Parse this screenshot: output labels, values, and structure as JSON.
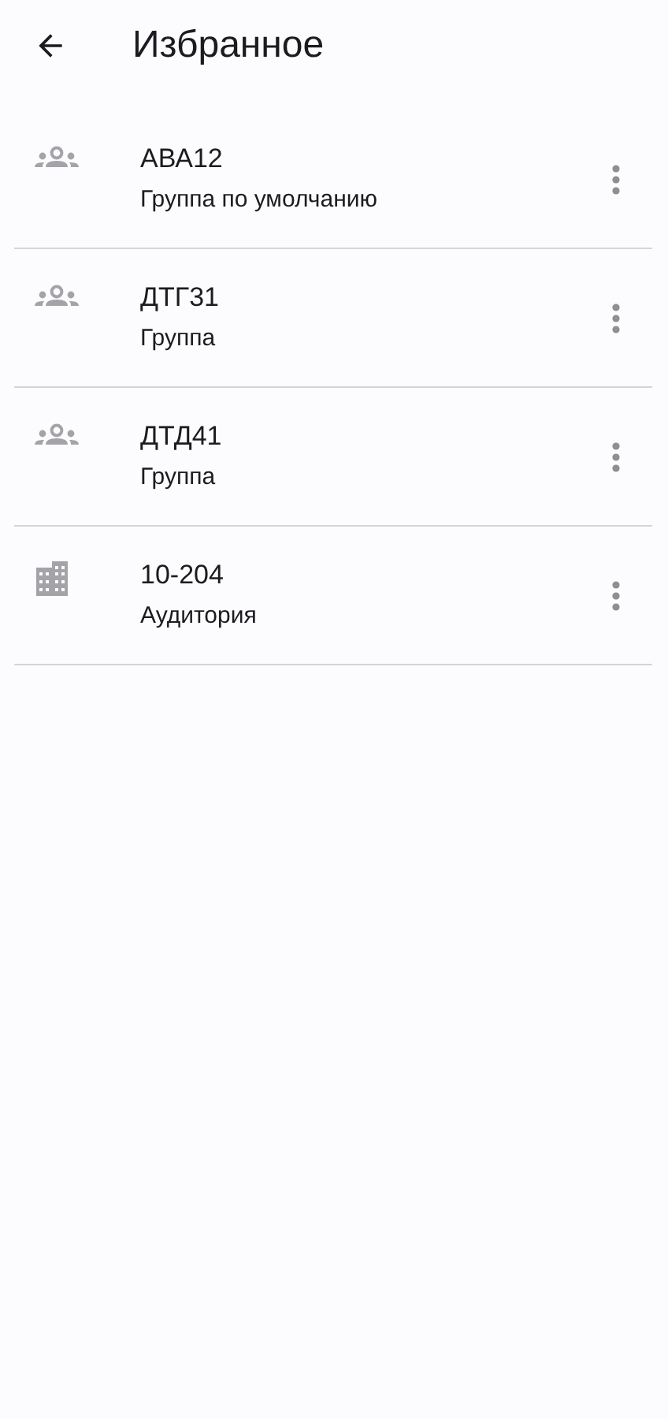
{
  "header": {
    "title": "Избранное"
  },
  "favorites": [
    {
      "kind": "group",
      "name": "АВА12",
      "subtitle": "Группа по умолчанию"
    },
    {
      "kind": "group",
      "name": "ДТГ31",
      "subtitle": "Группа"
    },
    {
      "kind": "group",
      "name": "ДТД41",
      "subtitle": "Группа"
    },
    {
      "kind": "room",
      "name": "10-204",
      "subtitle": "Аудитория"
    }
  ]
}
